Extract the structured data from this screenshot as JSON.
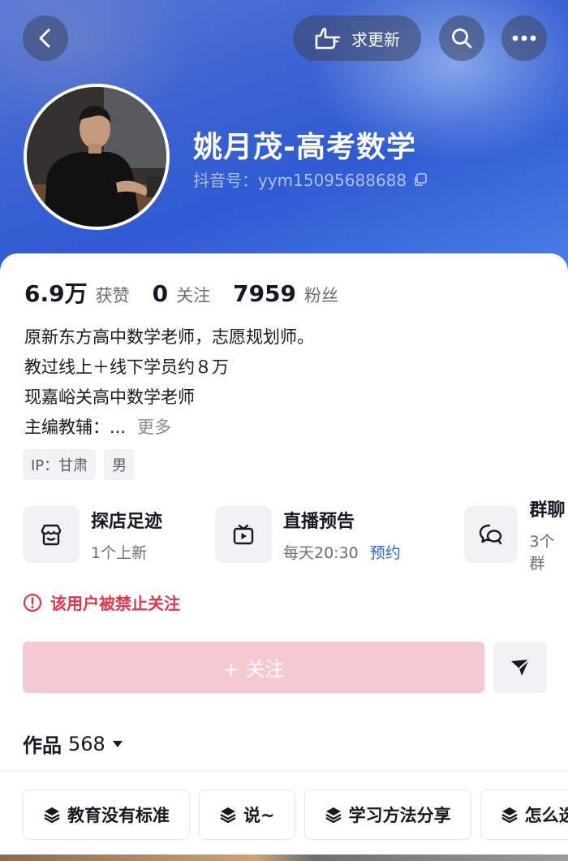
{
  "header": {
    "request_update_label": "求更新",
    "name": "姚月茂-高考数学",
    "douyin_id": "抖音号：yym15095688688"
  },
  "stats": [
    {
      "value": "6.9万",
      "label": "获赞"
    },
    {
      "value": "0",
      "label": "关注"
    },
    {
      "value": "7959",
      "label": "粉丝"
    }
  ],
  "bio": {
    "lines": [
      "原新东方高中数学老师，志愿规划师。",
      "教过线上＋线下学员约８万",
      "现嘉峪关高中数学老师",
      "主编教辅：..."
    ],
    "more_label": "更多"
  },
  "tags": [
    "IP：甘肃",
    "男"
  ],
  "features": [
    {
      "title": "探店足迹",
      "subtitle": "1个上新",
      "icon": "store-icon"
    },
    {
      "title": "直播预告",
      "subtitle": "每天20:30",
      "link": "预约",
      "icon": "tv-icon"
    },
    {
      "title": "群聊",
      "subtitle": "3个群",
      "icon": "chat-icon"
    }
  ],
  "warning_text": "该用户被禁止关注",
  "follow_label": "+ 关注",
  "works": {
    "label": "作品",
    "count": "568"
  },
  "collections": [
    "教育没有标准",
    "说~",
    "学习方法分享",
    "怎么选"
  ],
  "colors": {
    "accent_red": "#e8334a",
    "follow_disabled": "#f5c9d2",
    "link_blue": "#2b63d9",
    "header_blue": "#3c63d2"
  }
}
